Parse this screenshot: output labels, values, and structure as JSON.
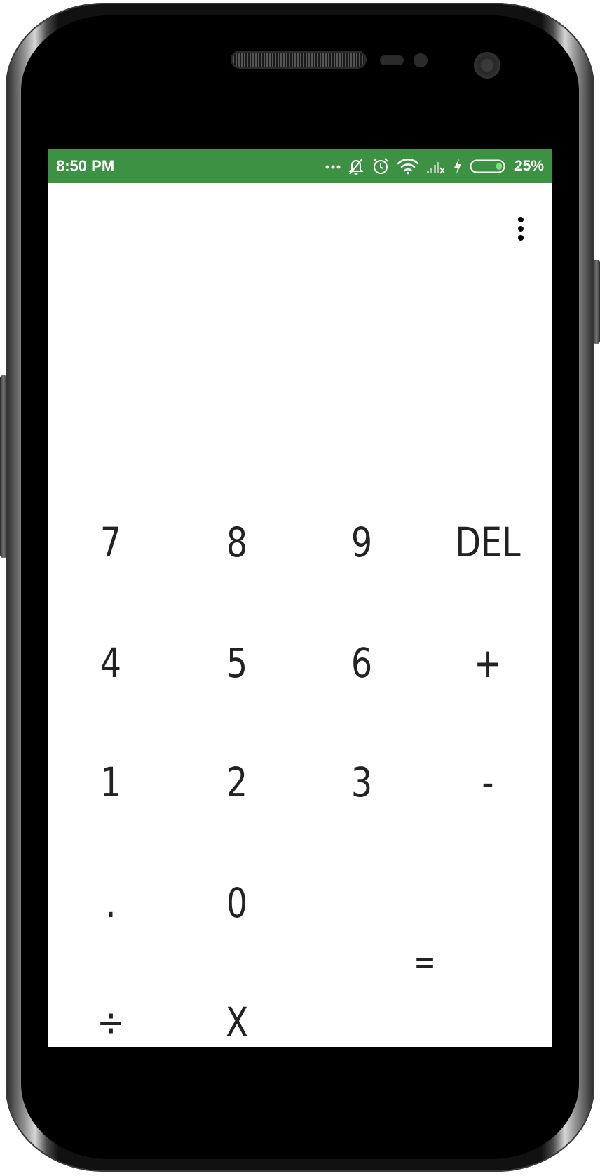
{
  "status_bar": {
    "time": "8:50 PM",
    "battery_percent": "25%",
    "battery_level": 0.25,
    "background_color": "#3d9142",
    "icons": [
      "more-dots-icon",
      "bell-muted-icon",
      "alarm-clock-icon",
      "wifi-icon",
      "cell-signal-icon",
      "charging-bolt-icon",
      "battery-icon"
    ]
  },
  "toolbar": {
    "overflow_icon": "more-vert-icon"
  },
  "keypad": {
    "row1": [
      "7",
      "8",
      "9",
      "DEL"
    ],
    "row2": [
      "4",
      "5",
      "6",
      "+"
    ],
    "row3": [
      "1",
      "2",
      "3",
      "-"
    ],
    "row4": [
      ".",
      "0"
    ],
    "row5": [
      "÷",
      "X"
    ],
    "equals": "="
  }
}
